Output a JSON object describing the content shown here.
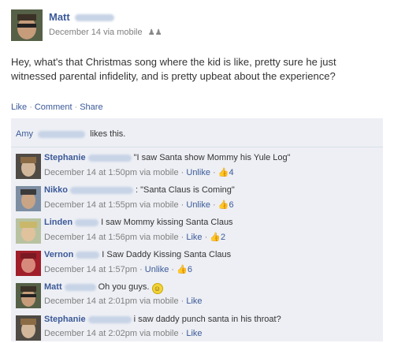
{
  "post": {
    "author": "Matt",
    "meta": "December 14 via mobile",
    "text": "Hey, what's that Christmas song where the kid is like, pretty sure he just witnessed parental infidelity, and is pretty upbeat about the experience?",
    "actions": [
      "Like",
      "Comment",
      "Share"
    ]
  },
  "likes": {
    "name": "Amy",
    "suffix": "likes this."
  },
  "comments": [
    {
      "name": "Stephanie",
      "text": "\"I saw Santa show Mommy his Yule Log\"",
      "time": "December 14 at 1:50pm via mobile",
      "action": "Unlike",
      "count": "4"
    },
    {
      "name": "Nikko",
      "text": ": \"Santa Claus is Coming\"",
      "time": "December 14 at 1:55pm via mobile",
      "action": "Unlike",
      "count": "6"
    },
    {
      "name": "Linden",
      "text": "I saw Mommy kissing Santa Claus",
      "time": "December 14 at 1:56pm via mobile",
      "action": "Like",
      "count": "2"
    },
    {
      "name": "Vernon",
      "text": "I Saw Daddy Kissing Santa Claus",
      "time": "December 14 at 1:57pm",
      "action": "Unlike",
      "count": "6"
    },
    {
      "name": "Matt",
      "text": "Oh you guys.",
      "time": "December 14 at 2:01pm via mobile",
      "action": "Like",
      "count": ""
    },
    {
      "name": "Stephanie",
      "text": "i saw daddy punch santa in his throat?",
      "time": "December 14 at 2:02pm via mobile",
      "action": "Like",
      "count": ""
    }
  ],
  "icons": {
    "thumb": "thumbs-up-icon",
    "smile": "smiley-icon",
    "group": "friends-icon"
  }
}
